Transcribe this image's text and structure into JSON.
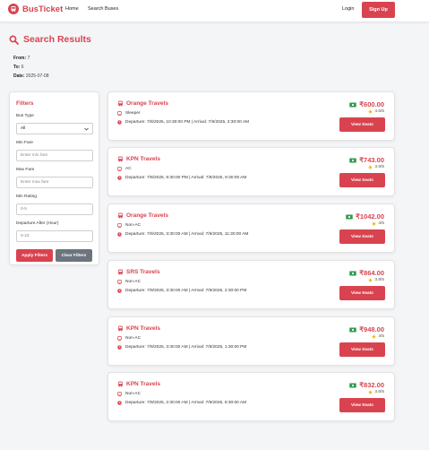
{
  "nav": {
    "brand": "BusTicket",
    "links": [
      "Home",
      "Search Buses"
    ],
    "login": "Login",
    "signup": "Sign Up"
  },
  "page": {
    "title": "Search Results",
    "from_label": "From:",
    "from_value": "7",
    "to_label": "To:",
    "to_value": "6",
    "date_label": "Date:",
    "date_value": "2025-07-08"
  },
  "filters": {
    "title": "Filters",
    "bus_type_label": "Bus Type",
    "bus_type_value": "All",
    "min_fare_label": "Min Fare",
    "min_fare_placeholder": "Enter min fare",
    "max_fare_label": "Max Fare",
    "max_fare_placeholder": "Enter max fare",
    "min_rating_label": "Min Rating",
    "min_rating_placeholder": "0-5",
    "departure_label": "Departure After (Hour)",
    "departure_placeholder": "0-23",
    "apply": "Apply Filters",
    "clear": "Clear Filters"
  },
  "colors": {
    "accent": "#d9434f",
    "money": "#2e9c4a",
    "star": "#f2b705",
    "secondary": "#6c757d"
  },
  "results": [
    {
      "operator": "Orange Travels",
      "type": "Sleeper",
      "times": "Departure: 7/8/2025, 10:30:00 PM | Arrival: 7/9/2025, 3:30:00 AM",
      "price": "₹600.00",
      "rating": "4.6/5",
      "button": "View Seats"
    },
    {
      "operator": "KPN Travels",
      "type": "AC",
      "times": "Departure: 7/8/2025, 9:30:00 PM | Arrival: 7/9/2025, 9:30:00 AM",
      "price": "₹743.00",
      "rating": "3.9/5",
      "button": "View Seats"
    },
    {
      "operator": "Orange Travels",
      "type": "Non-AC",
      "times": "Departure: 7/9/2025, 3:30:00 AM | Arrival: 7/9/2025, 11:30:00 AM",
      "price": "₹1042.00",
      "rating": "4/5",
      "button": "View Seats"
    },
    {
      "operator": "SRS Travels",
      "type": "Non-AC",
      "times": "Departure: 7/9/2025, 3:30:00 AM | Arrival: 7/9/2025, 2:30:00 PM",
      "price": "₹864.00",
      "rating": "3.8/5",
      "button": "View Seats"
    },
    {
      "operator": "KPN Travels",
      "type": "Non-AC",
      "times": "Departure: 7/9/2025, 3:30:00 AM | Arrival: 7/9/2025, 1:30:00 PM",
      "price": "₹948.00",
      "rating": "4/5",
      "button": "View Seats"
    },
    {
      "operator": "KPN Travels",
      "type": "Non-AC",
      "times": "Departure: 7/9/2025, 2:30:00 AM | Arrival: 7/9/2025, 8:30:00 AM",
      "price": "₹832.00",
      "rating": "3.6/5",
      "button": "View Seats"
    }
  ]
}
